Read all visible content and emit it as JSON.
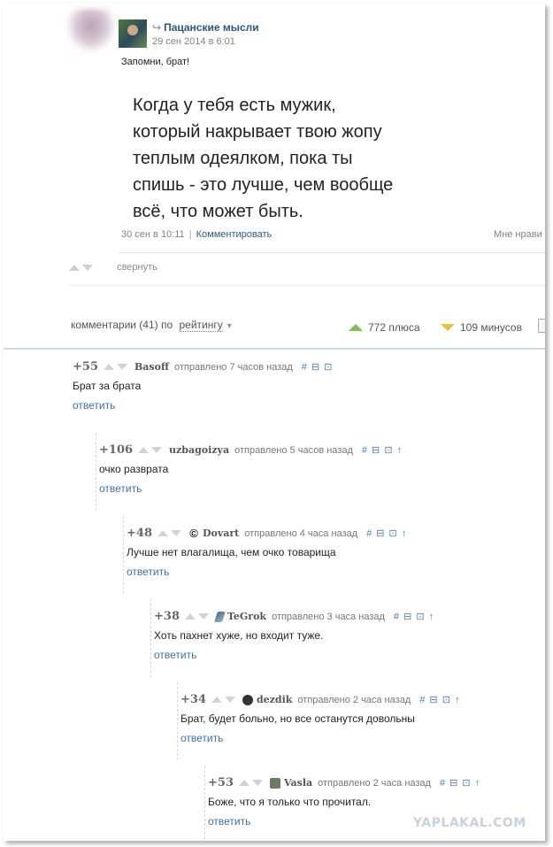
{
  "post": {
    "group_name": "Пацанские мысли",
    "date": "29 сен 2014 в 6:01",
    "lead": "Запомни, брат!",
    "quote": "Когда у тебя есть мужик,\nкоторый накрывает твою жопу\nтеплым одеялком, пока ты\nспишь - это лучше, чем вообще\nвсё, что может быть.",
    "meta_time": "30 сен в 10:11",
    "meta_separator": "|",
    "comment_link": "Комментировать",
    "like_label": "Мне нрави",
    "collapse_label": "свернуть"
  },
  "comments_header": {
    "label": "комментарии (41) по",
    "sort_label": "рейтингу",
    "plus_label": "772 плюса",
    "minus_label": "109 минусов"
  },
  "comments": [
    {
      "score": "+55",
      "author": "Basoff",
      "sent": "отправлено 7 часов назад",
      "tools": "# ⊟ ⊡",
      "text": "Брат за брата",
      "reply": "ответить"
    },
    {
      "score": "+106",
      "author": "uzbagoizya",
      "sent": "отправлено 5 часов назад",
      "tools": "# ⊟ ⊡ ↑",
      "text": "очко разврата",
      "reply": "ответить"
    },
    {
      "score": "+48",
      "author": "Dovart",
      "author_icon": "©",
      "sent": "отправлено 4 часа назад",
      "tools": "# ⊟ ⊡ ↑",
      "text": "Лучше нет влагалища, чем очко товарища",
      "reply": "ответить"
    },
    {
      "score": "+38",
      "author": "TeGrok",
      "sent": "отправлено 3 часа назад",
      "tools": "# ⊟ ⊡ ↑",
      "text": "Хоть пахнет хуже, но входит туже.",
      "reply": "ответить"
    },
    {
      "score": "+34",
      "author": "dezdik",
      "sent": "отправлено 2 часа назад",
      "tools": "# ⊟ ⊡ ↑",
      "text": "Брат, будет больно, но все останутся довольны",
      "reply": "ответить"
    },
    {
      "score": "+53",
      "author": "Vasla",
      "sent": "отправлено 2 часа назад",
      "tools": "# ⊟ ⊡ ↑",
      "text": "Боже, что я только что прочитал.",
      "reply": "ответить"
    }
  ],
  "watermark": "YAPLAKAL.COM",
  "colors": {
    "link": "#2a5885",
    "plus": "#7fc04f",
    "minus": "#e8c23a"
  }
}
